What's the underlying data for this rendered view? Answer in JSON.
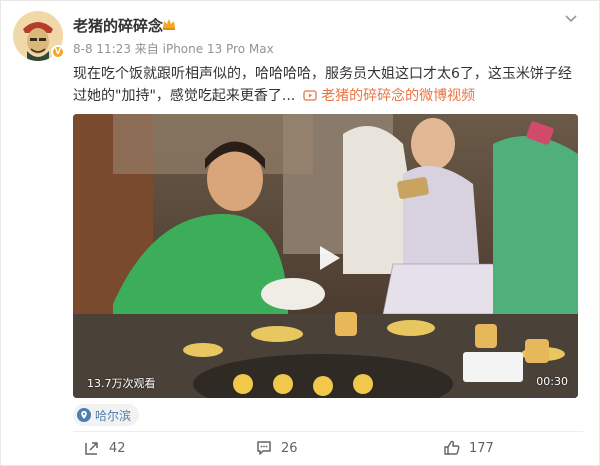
{
  "post": {
    "author": "老猪的碎碎念",
    "meta": "8-8 11:23 来自 iPhone 13 Pro Max",
    "text_main": "现在吃个饭就跟听相声似的，哈哈哈哈，服务员大姐这口才太6了，这玉米饼子经过她的\"加持\"，感觉吃起来更香了...",
    "video_link_label": "老猪的碎碎念的微博视频",
    "video": {
      "views": "13.7万次观看",
      "duration": "00:30"
    },
    "location": "哈尔滨"
  },
  "actions": {
    "repost_count": "42",
    "comment_count": "26",
    "like_count": "177"
  },
  "icons": {
    "avatar_badge": "v-verified-icon",
    "crown": "crown-icon",
    "chevron": "chevron-down-icon",
    "video_link": "video-link-icon",
    "play": "play-icon",
    "location": "location-pin-icon",
    "repost": "repost-icon",
    "comment": "comment-icon",
    "like": "thumb-up-icon"
  },
  "colors": {
    "accent_orange": "#eb7340",
    "link_blue": "#507daf",
    "meta_gray": "#939393"
  }
}
